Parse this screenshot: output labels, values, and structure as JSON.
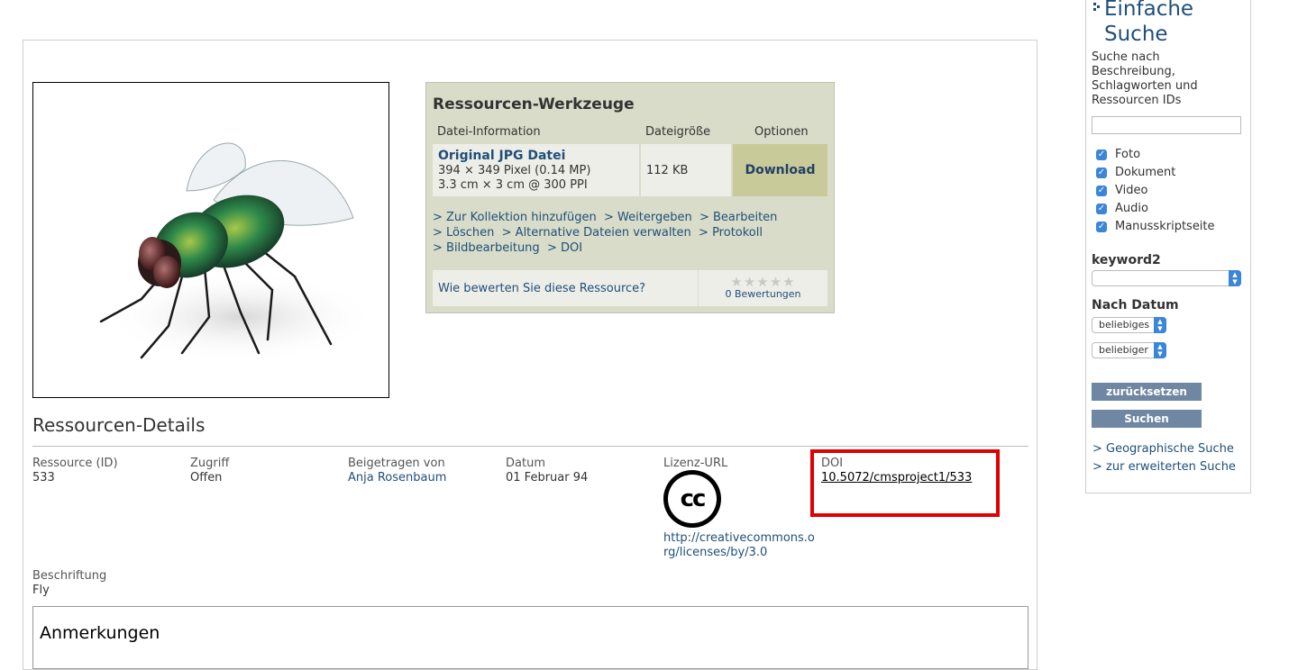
{
  "tools": {
    "title": "Ressourcen-Werkzeuge",
    "headers": {
      "file_info": "Datei-Information",
      "file_size": "Dateigröße",
      "options": "Optionen"
    },
    "file": {
      "name": "Original JPG Datei",
      "pixels": "394 × 349 Pixel (0.14 MP)",
      "print": "3.3 cm × 3 cm @ 300 PPI",
      "size": "112 KB",
      "download_label": "Download"
    },
    "links": [
      "> Zur Kollektion hinzufügen",
      "> Weitergeben",
      "> Bearbeiten",
      "> Löschen",
      "> Alternative Dateien verwalten",
      "> Protokoll",
      "> Bildbearbeitung",
      "> DOI"
    ],
    "rating_question": "Wie bewerten Sie diese Ressource?",
    "rating_count": "0 Bewertungen",
    "rating_value": 0,
    "rating_max": 5
  },
  "details": {
    "title": "Ressourcen-Details",
    "resource_id": {
      "label": "Ressource (ID)",
      "value": "533"
    },
    "access": {
      "label": "Zugriff",
      "value": "Offen"
    },
    "contributor": {
      "label": "Beigetragen von",
      "value": "Anja Rosenbaum"
    },
    "date": {
      "label": "Datum",
      "value": "01 Februar 94"
    },
    "license": {
      "label": "Lizenz-URL",
      "logo_text": "cc",
      "url": "http://creativecommons.org/licenses/by/3.0"
    },
    "doi": {
      "label": "DOI",
      "value": "10.5072/cmsproject1/533"
    },
    "caption": {
      "label": "Beschriftung",
      "value": "Fly"
    },
    "notes_title": "Anmerkungen"
  },
  "sidebar": {
    "title_line1": "Einfache",
    "title_line2": "Suche",
    "description": "Suche nach Beschreibung, Schlagworten und Ressourcen IDs",
    "search_value": "",
    "types": [
      "Foto",
      "Dokument",
      "Video",
      "Audio",
      "Manusskriptseite"
    ],
    "keyword_label": "keyword2",
    "keyword_value": "",
    "date_label": "Nach Datum",
    "date_from": "beliebiges",
    "date_to": "beliebiger",
    "reset_label": "zurücksetzen",
    "search_label": "Suchen",
    "geo_link": "> Geographische Suche",
    "advanced_link": "> zur erweiterten Suche"
  },
  "colors": {
    "link": "#1f4f7a",
    "tools_bg": "#d8dcc8",
    "download_bg": "#c9ca99",
    "highlight": "#e00000",
    "button": "#6f87a2",
    "checkbox": "#3b86d9"
  }
}
